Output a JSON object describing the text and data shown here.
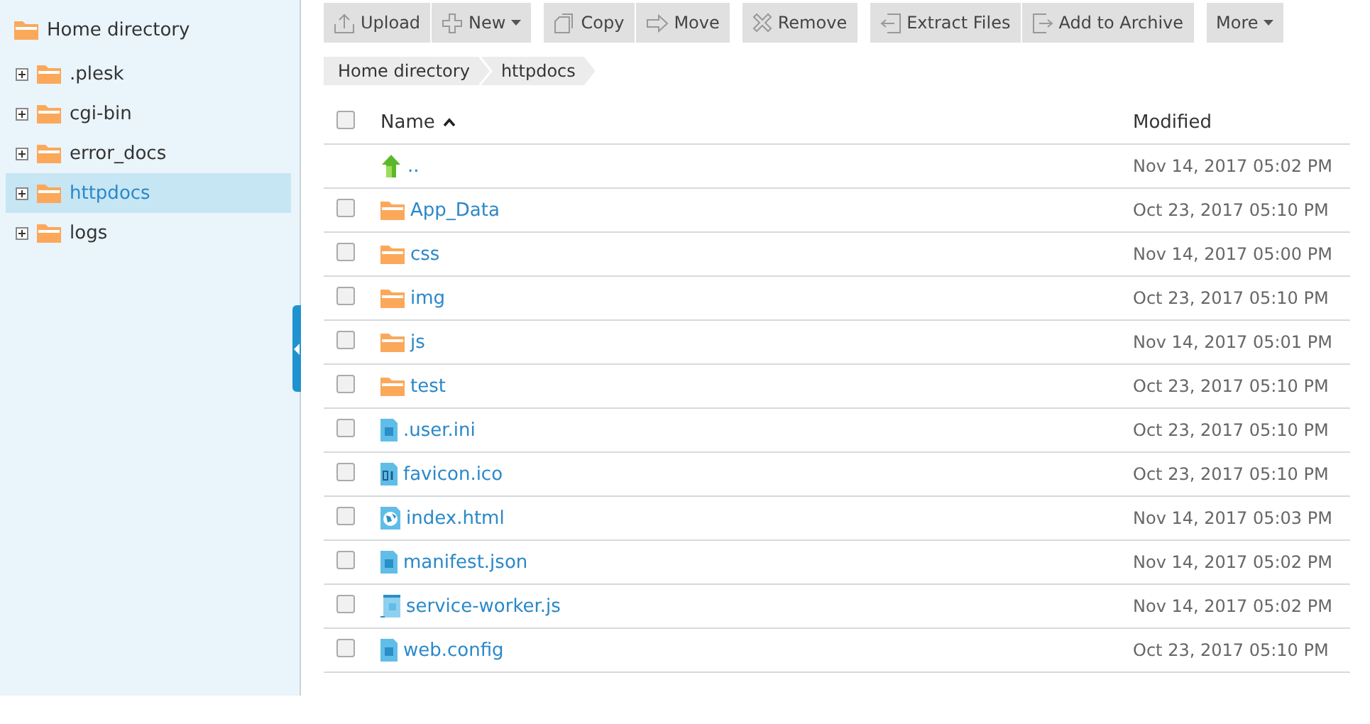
{
  "sidebar": {
    "root": {
      "label": "Home directory"
    },
    "items": [
      {
        "label": ".plesk",
        "selected": false,
        "expanded": false
      },
      {
        "label": "cgi-bin",
        "selected": false,
        "expanded": false
      },
      {
        "label": "error_docs",
        "selected": false,
        "expanded": false
      },
      {
        "label": "httpdocs",
        "selected": true,
        "expanded": false
      },
      {
        "label": "logs",
        "selected": false,
        "expanded": false
      }
    ]
  },
  "toolbar": {
    "groups": [
      [
        {
          "label": "Upload",
          "kind": "upload",
          "dropdown": false
        },
        {
          "label": "New",
          "kind": "plus",
          "dropdown": true
        }
      ],
      [
        {
          "label": "Copy",
          "kind": "copy",
          "dropdown": false
        },
        {
          "label": "Move",
          "kind": "move",
          "dropdown": false
        }
      ],
      [
        {
          "label": "Remove",
          "kind": "remove",
          "dropdown": false
        }
      ],
      [
        {
          "label": "Extract Files",
          "kind": "extract",
          "dropdown": false
        },
        {
          "label": "Add to Archive",
          "kind": "archive",
          "dropdown": false
        }
      ],
      [
        {
          "label": "More",
          "kind": "menu",
          "dropdown": true
        }
      ]
    ]
  },
  "breadcrumb": [
    "Home directory",
    "httpdocs"
  ],
  "table": {
    "columns": [
      {
        "label": "Name",
        "sorted": true
      },
      {
        "label": "Modified",
        "sorted": false
      }
    ],
    "header_checked": false,
    "rows": [
      {
        "kind": "parent",
        "name": "..",
        "modified": "Nov 14, 2017 05:02 PM"
      },
      {
        "kind": "folder",
        "name": "App_Data",
        "modified": "Oct 23, 2017 05:10 PM",
        "checked": false
      },
      {
        "kind": "folder",
        "name": "css",
        "modified": "Nov 14, 2017 05:00 PM",
        "checked": false
      },
      {
        "kind": "folder",
        "name": "img",
        "modified": "Oct 23, 2017 05:10 PM",
        "checked": false
      },
      {
        "kind": "folder",
        "name": "js",
        "modified": "Nov 14, 2017 05:01 PM",
        "checked": false
      },
      {
        "kind": "folder",
        "name": "test",
        "modified": "Oct 23, 2017 05:10 PM",
        "checked": false
      },
      {
        "kind": "file",
        "name": ".user.ini",
        "modified": "Oct 23, 2017 05:10 PM",
        "checked": false
      },
      {
        "kind": "binary",
        "name": "favicon.ico",
        "modified": "Oct 23, 2017 05:10 PM",
        "checked": false
      },
      {
        "kind": "web",
        "name": "index.html",
        "modified": "Nov 14, 2017 05:03 PM",
        "checked": false
      },
      {
        "kind": "file",
        "name": "manifest.json",
        "modified": "Nov 14, 2017 05:02 PM",
        "checked": false
      },
      {
        "kind": "script",
        "name": "service-worker.js",
        "modified": "Nov 14, 2017 05:02 PM",
        "checked": false
      },
      {
        "kind": "file",
        "name": "web.config",
        "modified": "Oct 23, 2017 05:10 PM",
        "checked": false
      }
    ]
  }
}
